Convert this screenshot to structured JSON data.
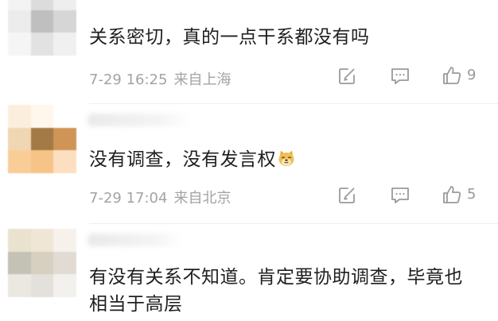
{
  "comments": [
    {
      "text": "关系密切，真的一点干系都没有吗",
      "time": "7-29 16:25",
      "location": "来自上海",
      "likes": "9",
      "avatar_colors": [
        "#f3f3f3",
        "#dcdcdc",
        "#eeeeee",
        "#ececec",
        "#bfbfbf",
        "#d6d6d6",
        "#f5f5f5",
        "#e2e2e2",
        "#f0f0f0"
      ]
    },
    {
      "text": "没有调查，没有发言权",
      "emoji": "doge-emoji",
      "time": "7-29 17:04",
      "location": "来自北京",
      "likes": "5",
      "avatar_colors": [
        "#fbeedd",
        "#fff6ec",
        "#ffffff",
        "#f0d6b2",
        "#a37a46",
        "#d09456",
        "#f9cd96",
        "#f7c488",
        "#fcdfc1"
      ]
    },
    {
      "text": "有没有关系不知道。肯定要协助调查，毕竟也相当于高层",
      "avatar_colors": [
        "#e9e2cf",
        "#efe6d6",
        "#f6f1ea",
        "#c4c1b5",
        "#d7cfbf",
        "#e1dbd4",
        "#ebe7e1",
        "#e4e0db",
        "#f3f1ee"
      ]
    }
  ],
  "icons": {
    "share": "share-icon",
    "comment": "comment-icon",
    "like": "thumbs-up-icon"
  }
}
